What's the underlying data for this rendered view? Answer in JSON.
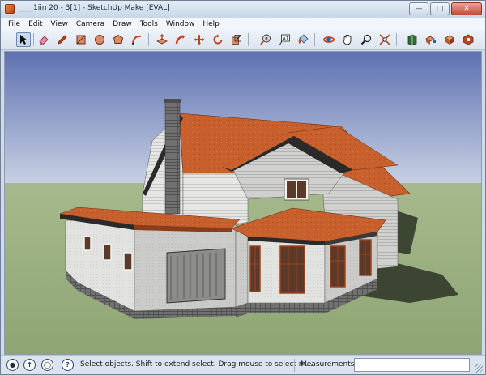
{
  "window": {
    "title": "____1iin 20 - 3[1] - SketchUp Make [EVAL]"
  },
  "menu": [
    "File",
    "Edit",
    "View",
    "Camera",
    "Draw",
    "Tools",
    "Window",
    "Help"
  ],
  "toolbar": {
    "tools": [
      {
        "name": "select-icon",
        "active": true
      },
      {
        "name": "eraser-icon"
      },
      {
        "name": "pencil-icon"
      },
      {
        "name": "rectangle-icon"
      },
      {
        "name": "circle-icon"
      },
      {
        "name": "polygon-icon"
      },
      {
        "name": "arc-icon"
      },
      {
        "name": "push-pull-icon"
      },
      {
        "name": "follow-me-icon"
      },
      {
        "name": "move-icon"
      },
      {
        "name": "rotate-icon"
      },
      {
        "name": "scale-icon"
      },
      {
        "name": "tape-measure-icon"
      },
      {
        "name": "text-icon",
        "glyph": "A1"
      },
      {
        "name": "paint-bucket-icon"
      },
      {
        "name": "orbit-icon"
      },
      {
        "name": "pan-icon"
      },
      {
        "name": "zoom-icon"
      },
      {
        "name": "zoom-extents-icon"
      },
      {
        "name": "warehouse-icon"
      },
      {
        "name": "share-model-icon"
      },
      {
        "name": "components-icon"
      },
      {
        "name": "extension-warehouse-icon"
      }
    ]
  },
  "status": {
    "hint": "Select objects. Shift to extend select. Drag mouse to select m...",
    "measurements_label": "Measurements",
    "measurements_value": ""
  },
  "colors": {
    "sky_top": "#5e71b2",
    "sky_horizon": "#c7d0e2",
    "ground": "#94ad79",
    "roof": "#c7602d",
    "wall": "#e4e4e2",
    "brick": "#6a6a6a"
  }
}
